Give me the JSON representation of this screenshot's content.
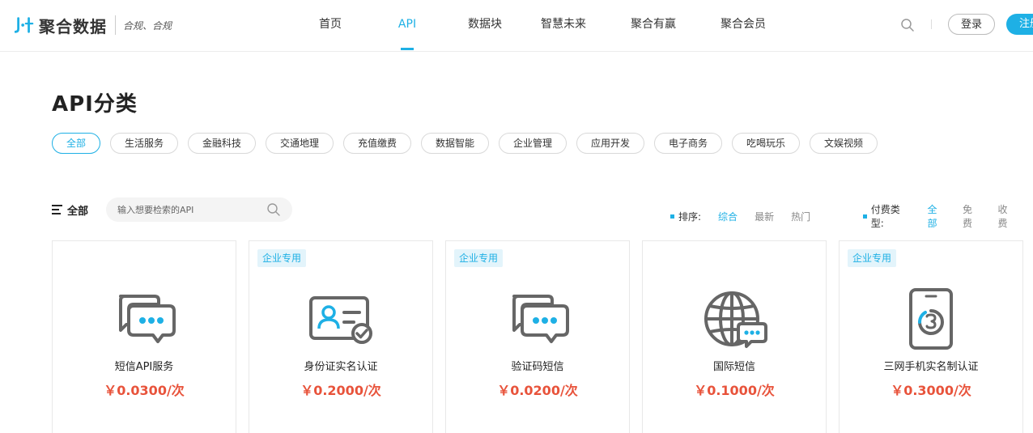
{
  "header": {
    "brand": "聚合数据",
    "slogan": "合规、合规",
    "nav": [
      {
        "label": "首页",
        "active": false
      },
      {
        "label": "API",
        "active": true
      },
      {
        "label": "数据块",
        "active": false
      },
      {
        "label": "智慧未来",
        "active": false
      },
      {
        "label": "聚合有赢",
        "active": false
      },
      {
        "label": "聚合会员",
        "active": false
      }
    ],
    "login_label": "登录",
    "register_label": "注册"
  },
  "categories": {
    "title": "API分类",
    "tags": [
      {
        "label": "全部",
        "active": true
      },
      {
        "label": "生活服务",
        "active": false
      },
      {
        "label": "金融科技",
        "active": false
      },
      {
        "label": "交通地理",
        "active": false
      },
      {
        "label": "充值缴费",
        "active": false
      },
      {
        "label": "数据智能",
        "active": false
      },
      {
        "label": "企业管理",
        "active": false
      },
      {
        "label": "应用开发",
        "active": false
      },
      {
        "label": "电子商务",
        "active": false
      },
      {
        "label": "吃喝玩乐",
        "active": false
      },
      {
        "label": "文娱视频",
        "active": false
      }
    ]
  },
  "filters": {
    "all_label": "全部",
    "search_placeholder": "输入想要检索的API",
    "sort": {
      "label": "排序:",
      "options": [
        {
          "label": "综合",
          "active": true
        },
        {
          "label": "最新",
          "active": false
        },
        {
          "label": "热门",
          "active": false
        }
      ]
    },
    "pay_type": {
      "label": "付费类型:",
      "options": [
        {
          "label": "全部",
          "active": true
        },
        {
          "label": "免费",
          "active": false
        },
        {
          "label": "收费",
          "active": false
        }
      ]
    }
  },
  "cards": [
    {
      "name": "短信API服务",
      "price": "￥0.0300/次",
      "badge": "",
      "icon": "chat-bubbles-icon"
    },
    {
      "name": "身份证实名认证",
      "price": "￥0.2000/次",
      "badge": "企业专用",
      "icon": "id-card-icon"
    },
    {
      "name": "验证码短信",
      "price": "￥0.0200/次",
      "badge": "企业专用",
      "icon": "chat-bubbles-icon"
    },
    {
      "name": "国际短信",
      "price": "￥0.1000/次",
      "badge": "",
      "icon": "globe-message-icon"
    },
    {
      "name": "三网手机实名制认证",
      "price": "￥0.3000/次",
      "badge": "企业专用",
      "icon": "phone-three-icon"
    }
  ],
  "colors": {
    "accent": "#1eb0e5",
    "price": "#e8533b",
    "icon_gray": "#666666",
    "badge_bg": "#e3f4fb"
  }
}
